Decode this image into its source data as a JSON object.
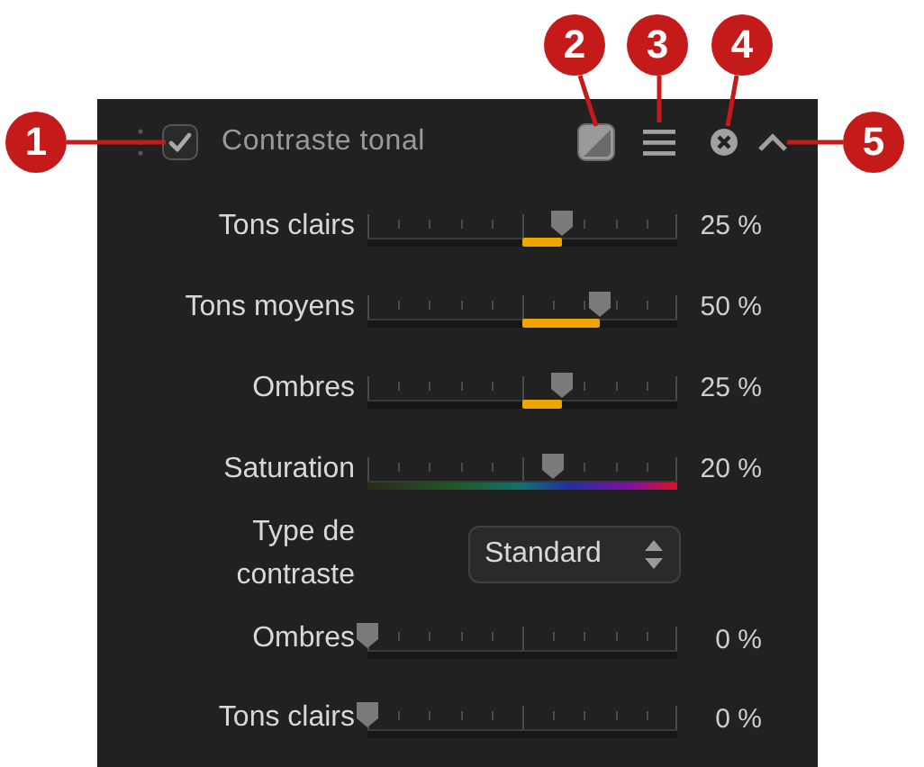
{
  "panel": {
    "title": "Contraste tonal",
    "checked": true
  },
  "rows": [
    {
      "kind": "bipolar",
      "label": "Tons clairs",
      "level": 0.625,
      "reading": "25 %"
    },
    {
      "kind": "bipolar",
      "label": "Tons moyens",
      "level": 0.75,
      "reading": "50 %"
    },
    {
      "kind": "bipolar",
      "label": "Ombres",
      "level": 0.625,
      "reading": "25 %"
    },
    {
      "kind": "hue",
      "label": "Saturation",
      "level": 0.6,
      "reading": "20 %"
    },
    {
      "kind": "select",
      "label": "Type de contraste",
      "value": "Standard"
    },
    {
      "kind": "plain",
      "label": "Ombres",
      "level": 0,
      "reading": "0 %"
    },
    {
      "kind": "plain",
      "label": "Tons clairs",
      "level": 0,
      "reading": "0 %"
    }
  ],
  "callouts": [
    {
      "label": "1"
    },
    {
      "label": "2"
    },
    {
      "label": "3"
    },
    {
      "label": "4"
    },
    {
      "label": "5"
    }
  ]
}
